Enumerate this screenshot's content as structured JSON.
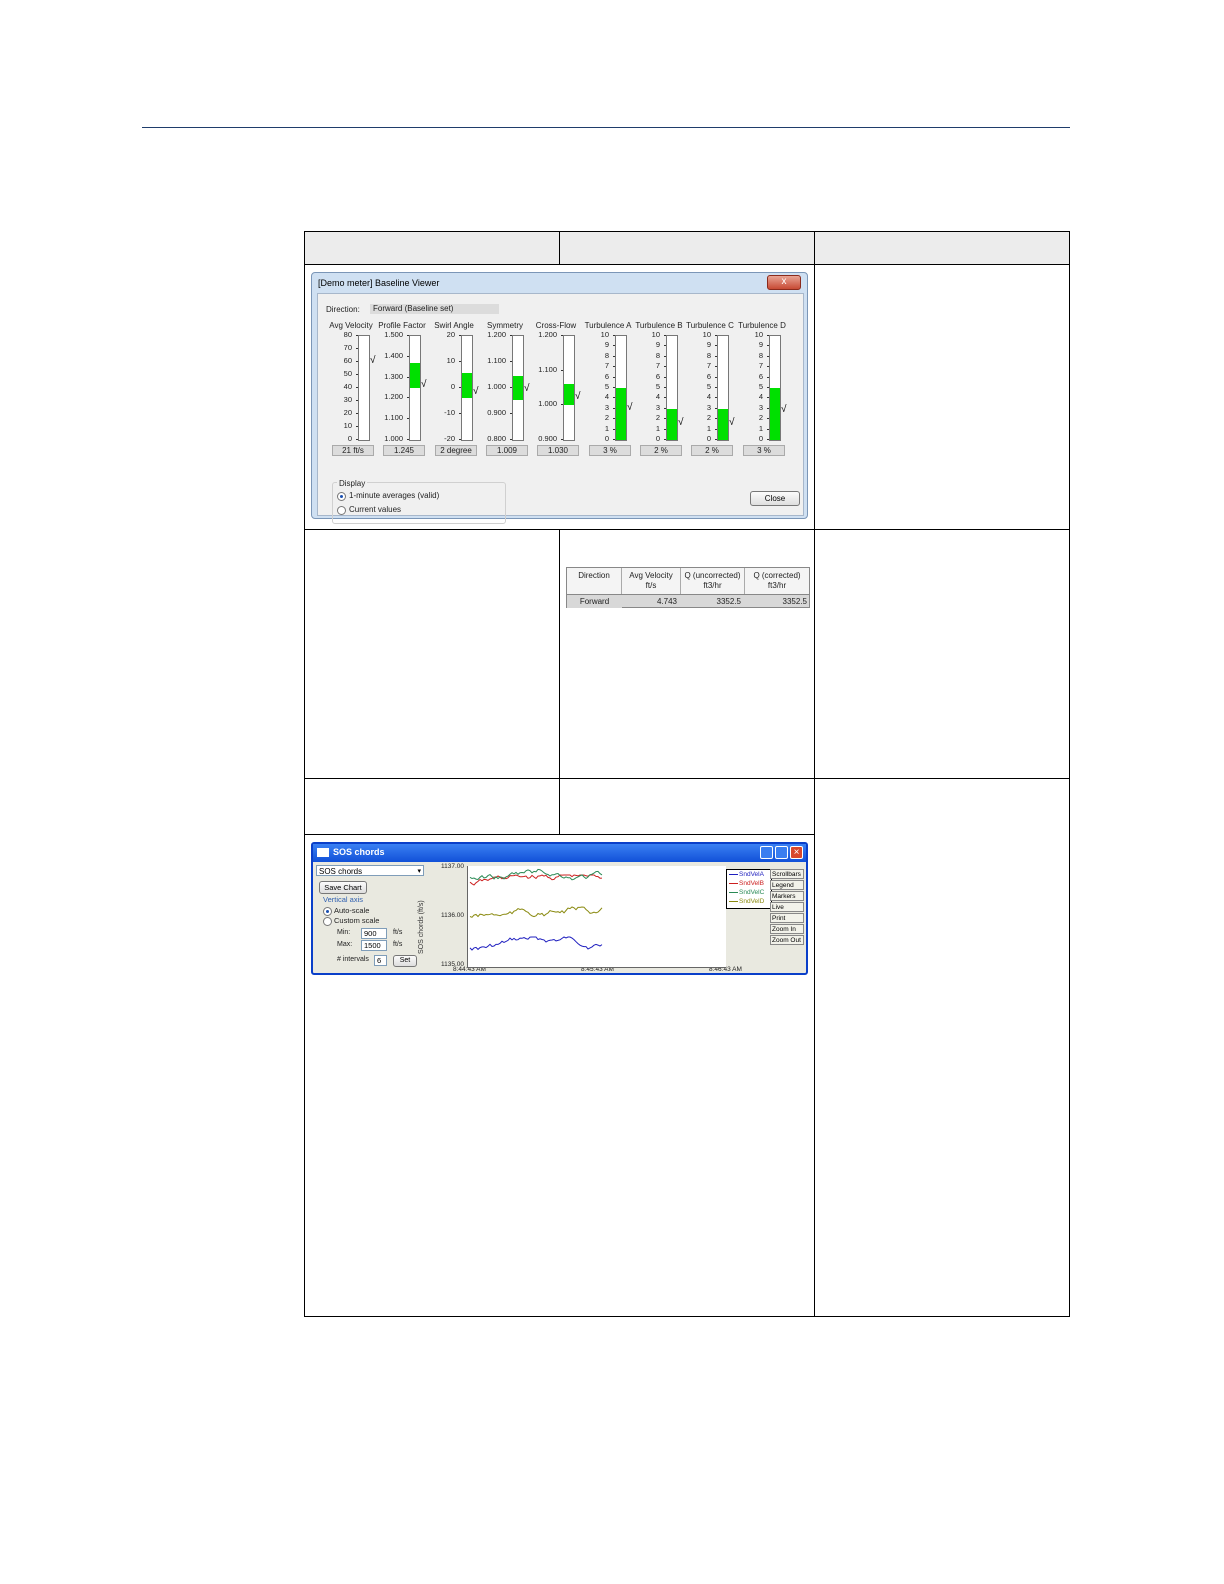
{
  "baseline_viewer": {
    "title": "[Demo meter] Baseline Viewer",
    "close_x": "x",
    "direction_label": "Direction:",
    "direction_value": "Forward (Baseline set)",
    "gauges": [
      {
        "label": "Avg Velocity",
        "ticks": [
          "80",
          "70",
          "60",
          "50",
          "40",
          "30",
          "20",
          "10",
          "0"
        ],
        "value": "21 ft/s",
        "fill": 0.0,
        "check": 0.75
      },
      {
        "label": "Profile Factor",
        "ticks": [
          "1.500",
          "1.400",
          "1.300",
          "1.200",
          "1.100",
          "1.000"
        ],
        "value": "1.245",
        "fill_from": 0.5,
        "fill_to": 0.74,
        "check": 0.52
      },
      {
        "label": "Swirl Angle",
        "ticks": [
          "20",
          "10",
          "0",
          "-10",
          "-20"
        ],
        "value": "2 degree",
        "fill_from": 0.4,
        "fill_to": 0.64,
        "check": 0.45
      },
      {
        "label": "Symmetry",
        "ticks": [
          "1.200",
          "1.100",
          "1.000",
          "0.900",
          "0.800"
        ],
        "value": "1.009",
        "fill_from": 0.38,
        "fill_to": 0.62,
        "check": 0.48
      },
      {
        "label": "Cross-Flow",
        "ticks": [
          "1.200",
          "1.100",
          "1.000",
          "0.900"
        ],
        "value": "1.030",
        "fill_from": 0.34,
        "fill_to": 0.54,
        "check": 0.4
      },
      {
        "label": "Turbulence A",
        "ticks": [
          "10",
          "9",
          "8",
          "7",
          "6",
          "5",
          "4",
          "3",
          "2",
          "1",
          "0"
        ],
        "value": "3 %",
        "fill_from": 0.0,
        "fill_to": 0.5,
        "check": 0.3
      },
      {
        "label": "Turbulence B",
        "ticks": [
          "10",
          "9",
          "8",
          "7",
          "6",
          "5",
          "4",
          "3",
          "2",
          "1",
          "0"
        ],
        "value": "2 %",
        "fill_from": 0.0,
        "fill_to": 0.3,
        "check": 0.15
      },
      {
        "label": "Turbulence C",
        "ticks": [
          "10",
          "9",
          "8",
          "7",
          "6",
          "5",
          "4",
          "3",
          "2",
          "1",
          "0"
        ],
        "value": "2 %",
        "fill_from": 0.0,
        "fill_to": 0.3,
        "check": 0.15
      },
      {
        "label": "Turbulence D",
        "ticks": [
          "10",
          "9",
          "8",
          "7",
          "6",
          "5",
          "4",
          "3",
          "2",
          "1",
          "0"
        ],
        "value": "3 %",
        "fill_from": 0.0,
        "fill_to": 0.5,
        "check": 0.28
      }
    ],
    "display_group_label": "Display",
    "radio_minute": "1-minute averages (valid)",
    "radio_current": "Current values",
    "close_button": "Close"
  },
  "flow_table": {
    "headers": [
      "Direction",
      "Avg Velocity\nft/s",
      "Q (uncorrected)\nft3/hr",
      "Q (corrected)\nft3/hr"
    ],
    "row": [
      "Forward",
      "4.743",
      "3352.5",
      "3352.5"
    ]
  },
  "sos_chords": {
    "title": "SOS chords",
    "selector_value": "SOS chords",
    "save_chart": "Save Chart",
    "vertical_axis_label": "Vertical axis",
    "auto_scale": "Auto-scale",
    "custom_scale": "Custom scale",
    "min_label": "Min:",
    "min_value": "900",
    "max_label": "Max:",
    "max_value": "1500",
    "unit": "ft/s",
    "intervals_label": "# intervals",
    "intervals_value": "6",
    "set_button": "Set",
    "y_axis_label": "SOS chords (ft/s)",
    "y_ticks": [
      "1137.00",
      "1136.00",
      "1135.00"
    ],
    "x_ticks": [
      "8:44:43 AM",
      "8:45:43 AM",
      "8:46:43 AM"
    ],
    "legend": [
      {
        "name": "SndVelA",
        "color": "#1f1fbf"
      },
      {
        "name": "SndVelB",
        "color": "#cc2020"
      },
      {
        "name": "SndVelC",
        "color": "#2a8a55"
      },
      {
        "name": "SndVelD",
        "color": "#8a8a10"
      }
    ],
    "side_buttons": [
      "Scrollbars",
      "Legend",
      "Markers",
      "Live",
      "Print",
      "Zoom In",
      "Zoom Out"
    ]
  }
}
